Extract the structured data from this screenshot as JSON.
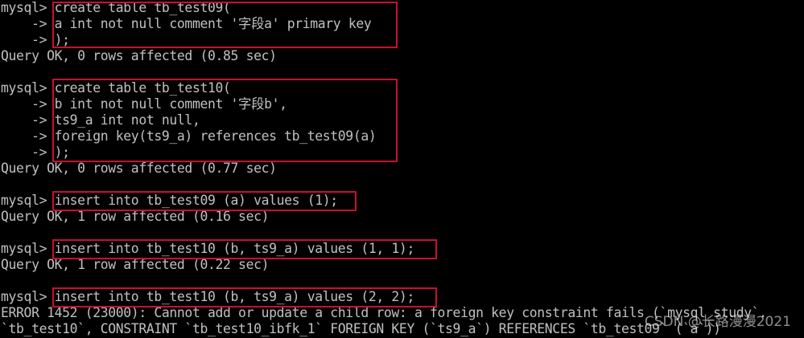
{
  "terminal": {
    "lines": [
      "mysql> create table tb_test09(",
      "    -> a int not null comment '字段a' primary key",
      "    -> );",
      "Query OK, 0 rows affected (0.85 sec)",
      "",
      "mysql> create table tb_test10(",
      "    -> b int not null comment '字段b',",
      "    -> ts9_a int not null,",
      "    -> foreign key(ts9_a) references tb_test09(a)",
      "    -> );",
      "Query OK, 0 rows affected (0.77 sec)",
      "",
      "mysql> insert into tb_test09 (a) values (1);",
      "Query OK, 1 row affected (0.16 sec)",
      "",
      "mysql> insert into tb_test10 (b, ts9_a) values (1, 1);",
      "Query OK, 1 row affected (0.22 sec)",
      "",
      "mysql> insert into tb_test10 (b, ts9_a) values (2, 2);",
      "ERROR 1452 (23000): Cannot add or update a child row: a foreign key constraint fails (`mysql_study`.",
      "`tb_test10`, CONSTRAINT `tb_test10_ibfk_1` FOREIGN KEY (`ts9_a`) REFERENCES `tb_test09` (`a`))"
    ]
  },
  "watermark": "CSDN @长路漫漫2021",
  "colors": {
    "background": "#000000",
    "text": "#c0c0c0",
    "highlight_border": "#c8102e"
  }
}
